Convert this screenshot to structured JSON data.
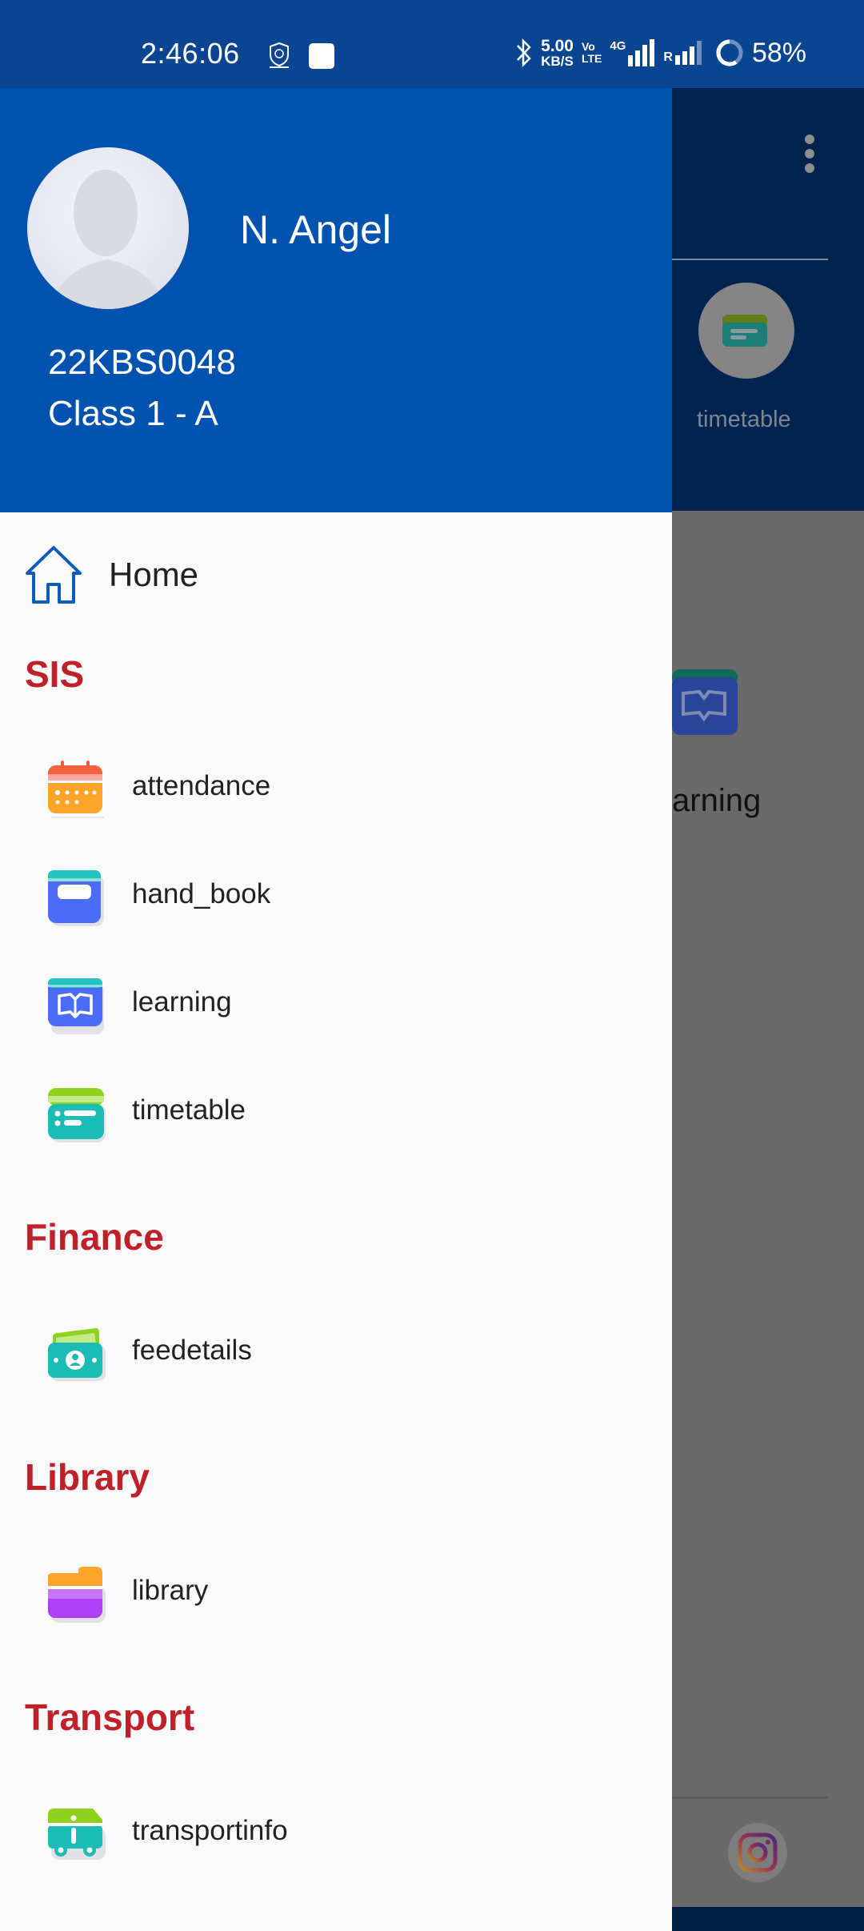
{
  "status_bar": {
    "time": "2:46:06",
    "notification_icons": [
      "kb-school-app-icon",
      "message-app-icon"
    ],
    "network_speed_value": "5.00",
    "network_speed_unit": "KB/S",
    "volte_top": "Vo",
    "volte_bottom": "LTE",
    "network_type": "4G",
    "roaming": "R",
    "battery_percent": "58%"
  },
  "drawer": {
    "profile": {
      "name": "N. Angel",
      "student_id": "22KBS0048",
      "class": "Class 1 - A"
    },
    "home": {
      "label": "Home",
      "icon": "home-icon"
    },
    "sections": [
      {
        "title": "SIS",
        "items": [
          {
            "label": "attendance",
            "icon": "calendar-icon"
          },
          {
            "label": "hand_book",
            "icon": "handbook-icon"
          },
          {
            "label": "learning",
            "icon": "open-book-icon"
          },
          {
            "label": "timetable",
            "icon": "timetable-icon"
          }
        ]
      },
      {
        "title": "Finance",
        "items": [
          {
            "label": "feedetails",
            "icon": "money-icon"
          }
        ]
      },
      {
        "title": "Library",
        "items": [
          {
            "label": "library",
            "icon": "folder-icon"
          }
        ]
      },
      {
        "title": "Transport",
        "items": [
          {
            "label": "transportinfo",
            "icon": "bus-info-icon"
          }
        ]
      }
    ]
  },
  "background_app": {
    "shortcut_timetable_label": "timetable",
    "shortcut_learning_label": "arning"
  },
  "colors": {
    "header_blue": "#0252b0",
    "status_bar_blue": "#0a4592",
    "section_red": "#c0202a",
    "drawer_bg": "#fafafa"
  }
}
